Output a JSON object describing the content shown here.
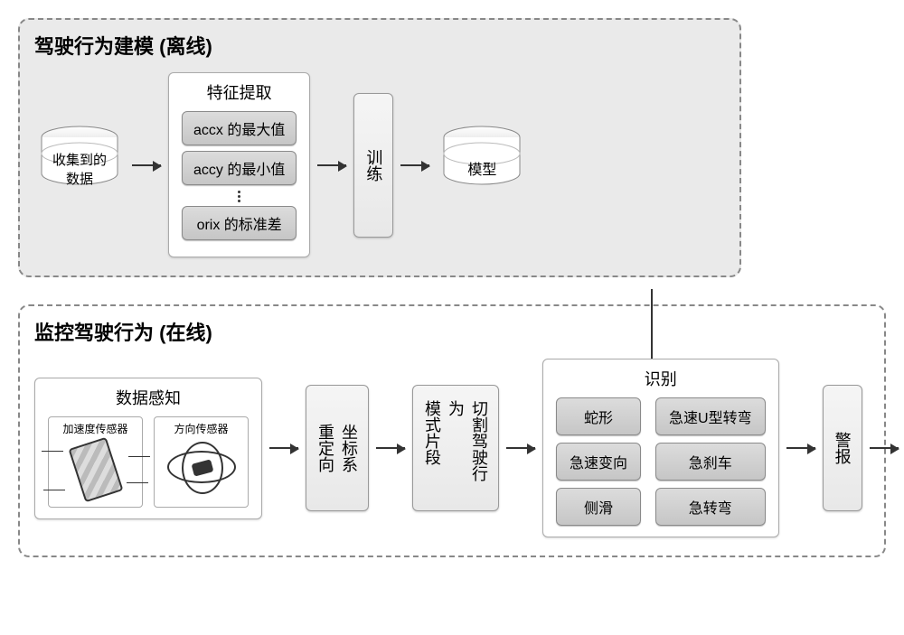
{
  "offline": {
    "title": "驾驶行为建模 (离线)",
    "collected": "收集到的\n数据",
    "feature_box_title": "特征提取",
    "features": [
      "accx 的最大值",
      "accy 的最小值",
      "orix 的标准差"
    ],
    "train": "训练",
    "model": "模型"
  },
  "online": {
    "title": "监控驾驶行为 (在线)",
    "sensing_title": "数据感知",
    "sensor_acc": "加速度传感器",
    "sensor_ori": "方向传感器",
    "reorient": "坐标系\n重定向",
    "segment": "切割驾驶行为\n模式片段",
    "recognize_title": "识别",
    "behaviors": [
      "蛇形",
      "急速U型转弯",
      "急速变向",
      "急刹车",
      "侧滑",
      "急转弯"
    ],
    "alert": "警报"
  }
}
